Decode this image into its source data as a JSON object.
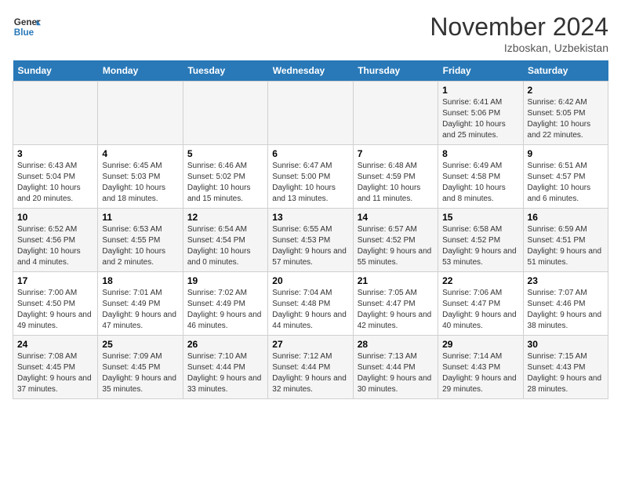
{
  "header": {
    "logo_general": "General",
    "logo_blue": "Blue",
    "month": "November 2024",
    "location": "Izboskan, Uzbekistan"
  },
  "weekdays": [
    "Sunday",
    "Monday",
    "Tuesday",
    "Wednesday",
    "Thursday",
    "Friday",
    "Saturday"
  ],
  "weeks": [
    [
      {
        "day": "",
        "info": ""
      },
      {
        "day": "",
        "info": ""
      },
      {
        "day": "",
        "info": ""
      },
      {
        "day": "",
        "info": ""
      },
      {
        "day": "",
        "info": ""
      },
      {
        "day": "1",
        "info": "Sunrise: 6:41 AM\nSunset: 5:06 PM\nDaylight: 10 hours and 25 minutes."
      },
      {
        "day": "2",
        "info": "Sunrise: 6:42 AM\nSunset: 5:05 PM\nDaylight: 10 hours and 22 minutes."
      }
    ],
    [
      {
        "day": "3",
        "info": "Sunrise: 6:43 AM\nSunset: 5:04 PM\nDaylight: 10 hours and 20 minutes."
      },
      {
        "day": "4",
        "info": "Sunrise: 6:45 AM\nSunset: 5:03 PM\nDaylight: 10 hours and 18 minutes."
      },
      {
        "day": "5",
        "info": "Sunrise: 6:46 AM\nSunset: 5:02 PM\nDaylight: 10 hours and 15 minutes."
      },
      {
        "day": "6",
        "info": "Sunrise: 6:47 AM\nSunset: 5:00 PM\nDaylight: 10 hours and 13 minutes."
      },
      {
        "day": "7",
        "info": "Sunrise: 6:48 AM\nSunset: 4:59 PM\nDaylight: 10 hours and 11 minutes."
      },
      {
        "day": "8",
        "info": "Sunrise: 6:49 AM\nSunset: 4:58 PM\nDaylight: 10 hours and 8 minutes."
      },
      {
        "day": "9",
        "info": "Sunrise: 6:51 AM\nSunset: 4:57 PM\nDaylight: 10 hours and 6 minutes."
      }
    ],
    [
      {
        "day": "10",
        "info": "Sunrise: 6:52 AM\nSunset: 4:56 PM\nDaylight: 10 hours and 4 minutes."
      },
      {
        "day": "11",
        "info": "Sunrise: 6:53 AM\nSunset: 4:55 PM\nDaylight: 10 hours and 2 minutes."
      },
      {
        "day": "12",
        "info": "Sunrise: 6:54 AM\nSunset: 4:54 PM\nDaylight: 10 hours and 0 minutes."
      },
      {
        "day": "13",
        "info": "Sunrise: 6:55 AM\nSunset: 4:53 PM\nDaylight: 9 hours and 57 minutes."
      },
      {
        "day": "14",
        "info": "Sunrise: 6:57 AM\nSunset: 4:52 PM\nDaylight: 9 hours and 55 minutes."
      },
      {
        "day": "15",
        "info": "Sunrise: 6:58 AM\nSunset: 4:52 PM\nDaylight: 9 hours and 53 minutes."
      },
      {
        "day": "16",
        "info": "Sunrise: 6:59 AM\nSunset: 4:51 PM\nDaylight: 9 hours and 51 minutes."
      }
    ],
    [
      {
        "day": "17",
        "info": "Sunrise: 7:00 AM\nSunset: 4:50 PM\nDaylight: 9 hours and 49 minutes."
      },
      {
        "day": "18",
        "info": "Sunrise: 7:01 AM\nSunset: 4:49 PM\nDaylight: 9 hours and 47 minutes."
      },
      {
        "day": "19",
        "info": "Sunrise: 7:02 AM\nSunset: 4:49 PM\nDaylight: 9 hours and 46 minutes."
      },
      {
        "day": "20",
        "info": "Sunrise: 7:04 AM\nSunset: 4:48 PM\nDaylight: 9 hours and 44 minutes."
      },
      {
        "day": "21",
        "info": "Sunrise: 7:05 AM\nSunset: 4:47 PM\nDaylight: 9 hours and 42 minutes."
      },
      {
        "day": "22",
        "info": "Sunrise: 7:06 AM\nSunset: 4:47 PM\nDaylight: 9 hours and 40 minutes."
      },
      {
        "day": "23",
        "info": "Sunrise: 7:07 AM\nSunset: 4:46 PM\nDaylight: 9 hours and 38 minutes."
      }
    ],
    [
      {
        "day": "24",
        "info": "Sunrise: 7:08 AM\nSunset: 4:45 PM\nDaylight: 9 hours and 37 minutes."
      },
      {
        "day": "25",
        "info": "Sunrise: 7:09 AM\nSunset: 4:45 PM\nDaylight: 9 hours and 35 minutes."
      },
      {
        "day": "26",
        "info": "Sunrise: 7:10 AM\nSunset: 4:44 PM\nDaylight: 9 hours and 33 minutes."
      },
      {
        "day": "27",
        "info": "Sunrise: 7:12 AM\nSunset: 4:44 PM\nDaylight: 9 hours and 32 minutes."
      },
      {
        "day": "28",
        "info": "Sunrise: 7:13 AM\nSunset: 4:44 PM\nDaylight: 9 hours and 30 minutes."
      },
      {
        "day": "29",
        "info": "Sunrise: 7:14 AM\nSunset: 4:43 PM\nDaylight: 9 hours and 29 minutes."
      },
      {
        "day": "30",
        "info": "Sunrise: 7:15 AM\nSunset: 4:43 PM\nDaylight: 9 hours and 28 minutes."
      }
    ]
  ]
}
